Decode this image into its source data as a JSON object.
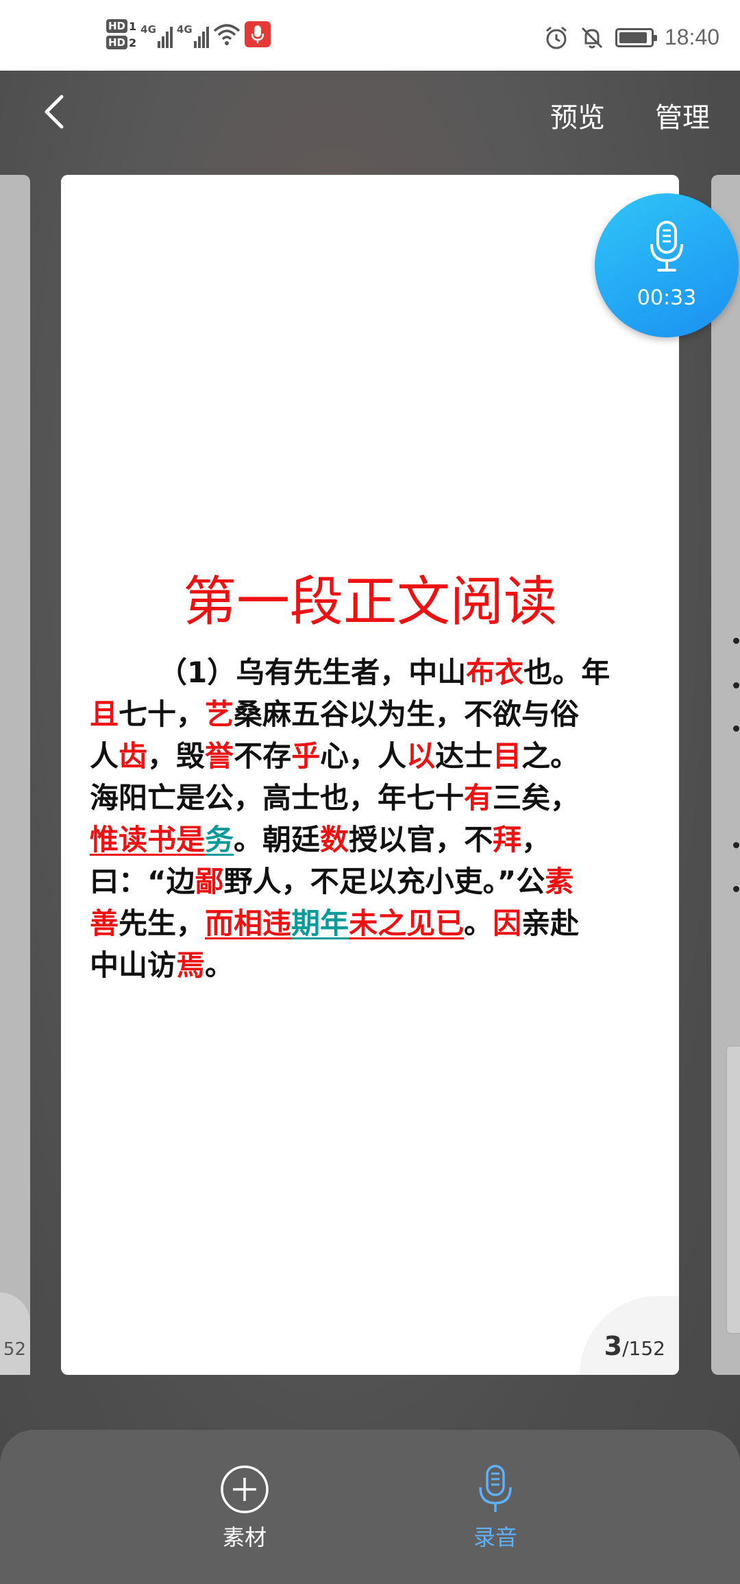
{
  "status_bar": {
    "sim1": "HD",
    "sim1_num": "1",
    "sim2": "HD",
    "sim2_num": "2",
    "net1": "4G",
    "net2": "4G",
    "time": "18:40",
    "icons": [
      "alarm-icon",
      "mute-bell-icon",
      "battery-icon"
    ],
    "battery_level": 0.9
  },
  "header": {
    "back_icon": "chevron-left-icon",
    "preview_label": "预览",
    "manage_label": "管理"
  },
  "record_bubble": {
    "icon": "microphone-icon",
    "elapsed": "00:33"
  },
  "document": {
    "title": "第一段正文阅读",
    "accent_color": "#ee1111",
    "teal_color": "#0a9a9a",
    "lines": [
      [
        {
          "text": "（1）乌有先生者，中山"
        },
        {
          "text": "布衣",
          "c": "r"
        },
        {
          "text": "也。年"
        }
      ],
      [
        {
          "text": "且",
          "c": "r"
        },
        {
          "text": "七十，"
        },
        {
          "text": "艺",
          "c": "r"
        },
        {
          "text": "桑麻五谷以为生，不欲与俗"
        }
      ],
      [
        {
          "text": "人"
        },
        {
          "text": "齿",
          "c": "r"
        },
        {
          "text": "，毁"
        },
        {
          "text": "誉",
          "c": "r"
        },
        {
          "text": "不存"
        },
        {
          "text": "乎",
          "c": "r"
        },
        {
          "text": "心，人"
        },
        {
          "text": "以",
          "c": "r"
        },
        {
          "text": "达士"
        },
        {
          "text": "目",
          "c": "r"
        },
        {
          "text": "之。"
        }
      ],
      [
        {
          "text": "海阳亡是公，高士也，年七十"
        },
        {
          "text": "有",
          "c": "r"
        },
        {
          "text": "三矣，"
        }
      ],
      [
        {
          "text": "惟读书是",
          "c": "r u"
        },
        {
          "text": "务",
          "c": "t u"
        },
        {
          "text": "。朝廷"
        },
        {
          "text": "数",
          "c": "r"
        },
        {
          "text": "授以官，不"
        },
        {
          "text": "拜",
          "c": "r"
        },
        {
          "text": "，"
        }
      ],
      [
        {
          "text": "曰：“边"
        },
        {
          "text": "鄙",
          "c": "r"
        },
        {
          "text": "野人，不足以充小吏。”公"
        },
        {
          "text": "素",
          "c": "r"
        }
      ],
      [
        {
          "text": "善",
          "c": "r"
        },
        {
          "text": "先生，"
        },
        {
          "text": "而相违",
          "c": "r u"
        },
        {
          "text": "期年",
          "c": "t u"
        },
        {
          "text": "未之见已",
          "c": "r u"
        },
        {
          "text": "。"
        },
        {
          "text": "因",
          "c": "r"
        },
        {
          "text": "亲赴"
        }
      ],
      [
        {
          "text": "中山访"
        },
        {
          "text": "焉",
          "c": "r"
        },
        {
          "text": "。"
        }
      ]
    ],
    "page_current": "3",
    "page_total": "/152"
  },
  "side_prev_page": "52",
  "bottom_tabs": {
    "materials_label": "素材",
    "materials_icon": "plus-circle-icon",
    "record_label": "录音",
    "record_icon": "microphone-icon",
    "active_color": "#5db1ff"
  }
}
